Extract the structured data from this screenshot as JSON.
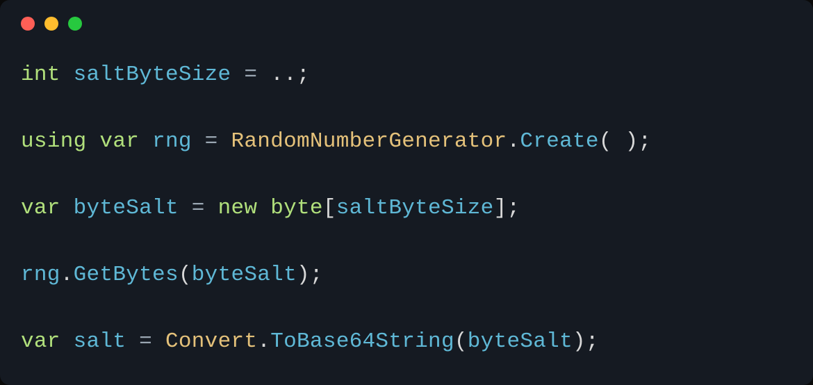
{
  "window": {
    "buttons": [
      "close",
      "minimize",
      "zoom"
    ]
  },
  "code": {
    "lines": [
      [
        {
          "t": "kw",
          "v": "int"
        },
        {
          "t": "sp",
          "v": " "
        },
        {
          "t": "ident",
          "v": "saltByteSize"
        },
        {
          "t": "sp",
          "v": " "
        },
        {
          "t": "op",
          "v": "="
        },
        {
          "t": "sp",
          "v": " "
        },
        {
          "t": "dots",
          "v": ".."
        },
        {
          "t": "punc",
          "v": ";"
        }
      ],
      [],
      [
        {
          "t": "kw",
          "v": "using"
        },
        {
          "t": "sp",
          "v": " "
        },
        {
          "t": "kw",
          "v": "var"
        },
        {
          "t": "sp",
          "v": " "
        },
        {
          "t": "ident",
          "v": "rng"
        },
        {
          "t": "sp",
          "v": " "
        },
        {
          "t": "op",
          "v": "="
        },
        {
          "t": "sp",
          "v": " "
        },
        {
          "t": "class",
          "v": "RandomNumberGenerator"
        },
        {
          "t": "punc",
          "v": "."
        },
        {
          "t": "method",
          "v": "Create"
        },
        {
          "t": "punc",
          "v": "( )"
        },
        {
          "t": "punc",
          "v": ";"
        }
      ],
      [],
      [
        {
          "t": "kw",
          "v": "var"
        },
        {
          "t": "sp",
          "v": " "
        },
        {
          "t": "ident",
          "v": "byteSalt"
        },
        {
          "t": "sp",
          "v": " "
        },
        {
          "t": "op",
          "v": "="
        },
        {
          "t": "sp",
          "v": " "
        },
        {
          "t": "kw",
          "v": "new"
        },
        {
          "t": "sp",
          "v": " "
        },
        {
          "t": "kw",
          "v": "byte"
        },
        {
          "t": "punc",
          "v": "["
        },
        {
          "t": "ident",
          "v": "saltByteSize"
        },
        {
          "t": "punc",
          "v": "]"
        },
        {
          "t": "punc",
          "v": ";"
        }
      ],
      [],
      [
        {
          "t": "ident",
          "v": "rng"
        },
        {
          "t": "punc",
          "v": "."
        },
        {
          "t": "method",
          "v": "GetBytes"
        },
        {
          "t": "punc",
          "v": "("
        },
        {
          "t": "ident",
          "v": "byteSalt"
        },
        {
          "t": "punc",
          "v": ")"
        },
        {
          "t": "punc",
          "v": ";"
        }
      ],
      [],
      [
        {
          "t": "kw",
          "v": "var"
        },
        {
          "t": "sp",
          "v": " "
        },
        {
          "t": "ident",
          "v": "salt"
        },
        {
          "t": "sp",
          "v": " "
        },
        {
          "t": "op",
          "v": "="
        },
        {
          "t": "sp",
          "v": " "
        },
        {
          "t": "class",
          "v": "Convert"
        },
        {
          "t": "punc",
          "v": "."
        },
        {
          "t": "method",
          "v": "ToBase64String"
        },
        {
          "t": "punc",
          "v": "("
        },
        {
          "t": "ident",
          "v": "byteSalt"
        },
        {
          "t": "punc",
          "v": ")"
        },
        {
          "t": "punc",
          "v": ";"
        }
      ]
    ]
  }
}
